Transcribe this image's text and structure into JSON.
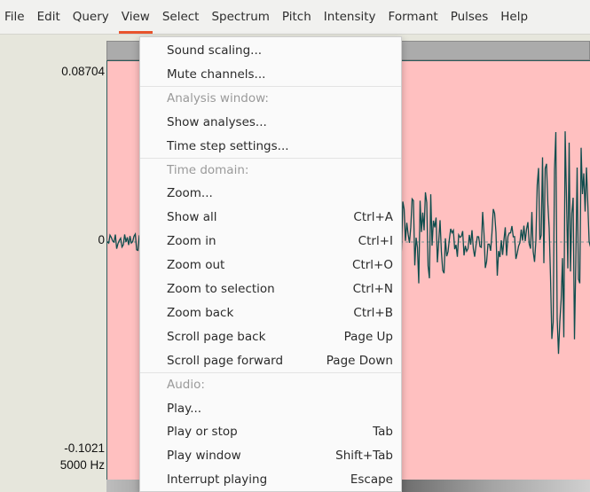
{
  "menubar": {
    "items": [
      "File",
      "Edit",
      "Query",
      "View",
      "Select",
      "Spectrum",
      "Pitch",
      "Intensity",
      "Formant",
      "Pulses",
      "Help"
    ],
    "active": "View"
  },
  "axis": {
    "y_top": "0.08704",
    "y_zero": "0",
    "y_bottom": "-0.1021",
    "freq_top": "5000 Hz"
  },
  "colors": {
    "panel": "#ffc0c0",
    "wave": "#0f4d4d",
    "accent": "#e9542d"
  },
  "view_menu": {
    "items": [
      {
        "label": "Sound scaling...",
        "shortcut": ""
      },
      {
        "label": "Mute channels...",
        "shortcut": ""
      },
      {
        "label": "Analysis window:",
        "shortcut": "",
        "header": true
      },
      {
        "label": "Show analyses...",
        "shortcut": ""
      },
      {
        "label": "Time step settings...",
        "shortcut": ""
      },
      {
        "label": "Time domain:",
        "shortcut": "",
        "header": true
      },
      {
        "label": "Zoom...",
        "shortcut": ""
      },
      {
        "label": "Show all",
        "shortcut": "Ctrl+A"
      },
      {
        "label": "Zoom in",
        "shortcut": "Ctrl+I"
      },
      {
        "label": "Zoom out",
        "shortcut": "Ctrl+O"
      },
      {
        "label": "Zoom to selection",
        "shortcut": "Ctrl+N"
      },
      {
        "label": "Zoom back",
        "shortcut": "Ctrl+B"
      },
      {
        "label": "Scroll page back",
        "shortcut": "Page Up"
      },
      {
        "label": "Scroll page forward",
        "shortcut": "Page Down"
      },
      {
        "label": "Audio:",
        "shortcut": "",
        "header": true
      },
      {
        "label": "Play...",
        "shortcut": ""
      },
      {
        "label": "Play or stop",
        "shortcut": "Tab"
      },
      {
        "label": "Play window",
        "shortcut": "Shift+Tab"
      },
      {
        "label": "Interrupt playing",
        "shortcut": "Escape"
      }
    ]
  }
}
